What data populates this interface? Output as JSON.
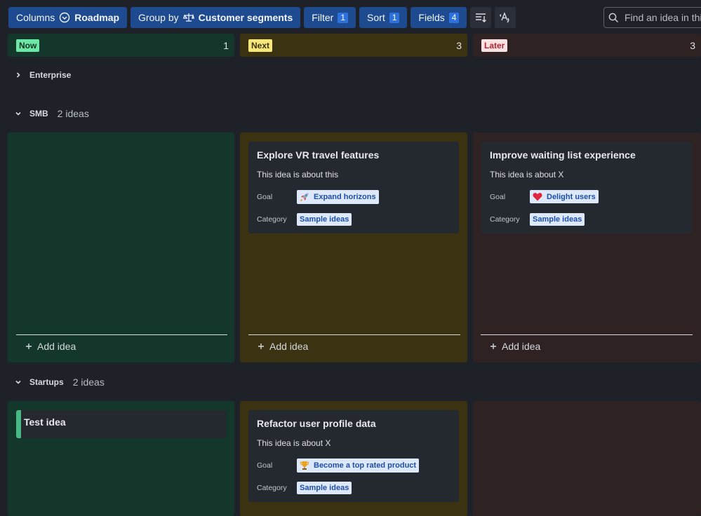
{
  "toolbar": {
    "columns_label": "Columns",
    "columns_value": "Roadmap",
    "group_label": "Group by",
    "group_value": "Customer segments",
    "filter_label": "Filter",
    "filter_count": "1",
    "sort_label": "Sort",
    "sort_count": "1",
    "fields_label": "Fields",
    "fields_count": "4",
    "search_placeholder": "Find an idea in this"
  },
  "columns": [
    {
      "label": "Now",
      "count": "1",
      "badge_bg": "#6ee7a6",
      "badge_fg": "#0d3321",
      "header_bg": "#13372a"
    },
    {
      "label": "Next",
      "count": "3",
      "badge_bg": "#f6e67c",
      "badge_fg": "#3b3005",
      "header_bg": "#3a3210"
    },
    {
      "label": "Later",
      "count": "3",
      "badge_bg": "#fde2e2",
      "badge_fg": "#b3262f",
      "header_bg": "#2e2222"
    }
  ],
  "groups": [
    {
      "name": "Enterprise",
      "count": "",
      "expanded": false
    },
    {
      "name": "SMB",
      "count": "2 ideas",
      "expanded": true
    },
    {
      "name": "Startups",
      "count": "2 ideas",
      "expanded": true
    }
  ],
  "cards": {
    "smb_next": {
      "title": "Explore VR travel features",
      "desc": "This idea is about this",
      "goal_label": "Goal",
      "goal_icon": "rocket-icon",
      "goal": "Expand horizons",
      "category_label": "Category",
      "category": "Sample ideas"
    },
    "smb_later": {
      "title": "Improve waiting list experience",
      "desc": "This idea is about X",
      "goal_label": "Goal",
      "goal_icon": "heart-icon",
      "goal": "Delight users",
      "category_label": "Category",
      "category": "Sample ideas"
    },
    "startups_now": {
      "title": "Test idea",
      "accent": "#47b985"
    },
    "startups_next": {
      "title": "Refactor user profile data",
      "desc": "This idea is about X",
      "goal_label": "Goal",
      "goal_icon": "trophy-icon",
      "goal": "Become a top rated product",
      "category_label": "Category",
      "category": "Sample ideas"
    }
  },
  "add_idea_label": "Add idea"
}
